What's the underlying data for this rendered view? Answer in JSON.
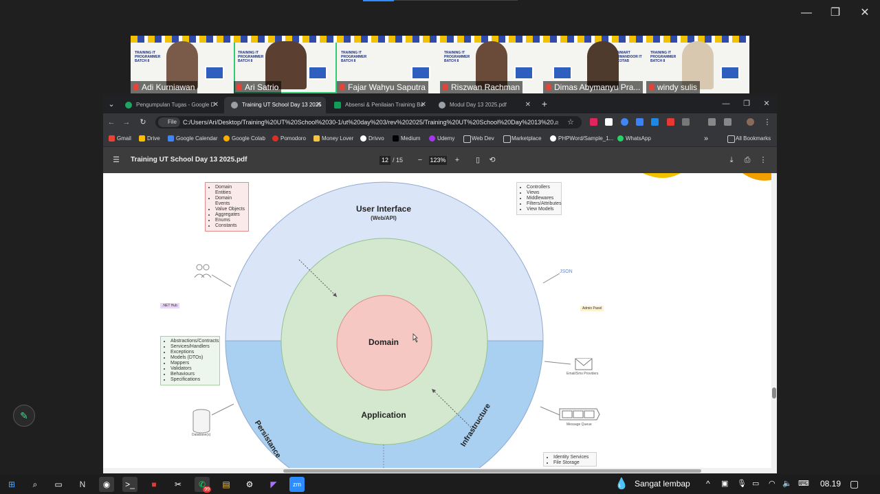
{
  "window": {
    "minimize": "—",
    "restore": "❐",
    "close": "✕"
  },
  "participants": [
    {
      "name": "Adi Kurniawan",
      "banner": "TRAINING IT PROGRAMMER BATCH 8"
    },
    {
      "name": "Ari Satrio",
      "banner": "TRAINING IT PROGRAMMER BATCH 8"
    },
    {
      "name": "Fajar Wahyu Saputra",
      "banner": "TRAINING IT PROGRAMMER BATCH 8"
    },
    {
      "name": "Riszwan Rachman",
      "banner": "TRAINING IT PROGRAMMER BATCH 8"
    },
    {
      "name": "Dimas Abymanyu Pra...",
      "banner": "ONNIART KOMANDOOR IT BKOTAB"
    },
    {
      "name": "windy sulis",
      "banner": "TRAINING IT PROGRAMMER BATCH 8"
    }
  ],
  "browser": {
    "tabs": [
      {
        "label": "Pengumpulan Tugas - Google D",
        "icon_color": "#1fa463"
      },
      {
        "label": "Training UT School Day 13 2025",
        "icon_color": "#9aa0a6"
      },
      {
        "label": "Absensi & Penilaian Training Ba",
        "icon_color": "#0f9d58"
      },
      {
        "label": "Modul Day 13 2025.pdf",
        "icon_color": "#9aa0a6"
      }
    ],
    "new_tab": "+",
    "address_chip": "File",
    "url": "C:/Users/Ari/Desktop/Training%20UT%20School%2030-1/ut%20day%203/rev%202025/Training%20UT%20School%20Day%2013%20...",
    "bookmarks": [
      {
        "label": "Gmail",
        "color": "#ea4335"
      },
      {
        "label": "Drive",
        "color": "#fbbc04"
      },
      {
        "label": "Google Calendar",
        "color": "#4285f4"
      },
      {
        "label": "Google Colab",
        "color": "#f9ab00"
      },
      {
        "label": "Pomodoro",
        "color": "#d93025"
      },
      {
        "label": "Money Lover",
        "color": "#f6c343"
      },
      {
        "label": "Drivvo",
        "color": "#ffffff"
      },
      {
        "label": "Medium",
        "color": "#000000"
      },
      {
        "label": "Udemy",
        "color": "#a435f0"
      },
      {
        "label": "Web Dev",
        "color": "#cccccc"
      },
      {
        "label": "Marketplace",
        "color": "#cccccc"
      },
      {
        "label": "PHPWord/Sample_1...",
        "color": "#ffffff"
      },
      {
        "label": "WhatsApp",
        "color": "#25d366"
      }
    ],
    "all_bookmarks": "All Bookmarks"
  },
  "pdf": {
    "title": "Training UT School Day 13 2025.pdf",
    "page": "12",
    "total": "/ 15",
    "zoom": "123%"
  },
  "diagram": {
    "ui_label": "User Interface",
    "ui_sub": "(Web/API)",
    "domain": "Domain",
    "application": "Application",
    "persistence": "Persistance",
    "infrastructure": "Infrastructure",
    "domain_note": [
      "Domain Entities",
      "Domain Events",
      "Value Objects",
      "Aggregates",
      "Enums",
      "Constants"
    ],
    "ui_note": [
      "Controllers",
      "Views",
      "Middlewares",
      "Filters/Attributes",
      "View Models"
    ],
    "app_note": [
      "Abstractions/Contracts",
      "Services/Handlers",
      "Exceptions",
      "Models (DTOs)",
      "Mappers",
      "Validators",
      "Behaviours",
      "Specifications"
    ],
    "infra_note": [
      "Identity Services",
      "File Storage"
    ],
    "json_label": "JSON",
    "net_hub": ".NET Hub",
    "admin_panel": "Admin Panel",
    "email_label": "Email/Sms Providers",
    "queue_label": "Message Queue",
    "db_label": "Database(s)"
  },
  "taskbar": {
    "weather": "Sangat lembap",
    "time": "08.19",
    "badge": "99"
  }
}
